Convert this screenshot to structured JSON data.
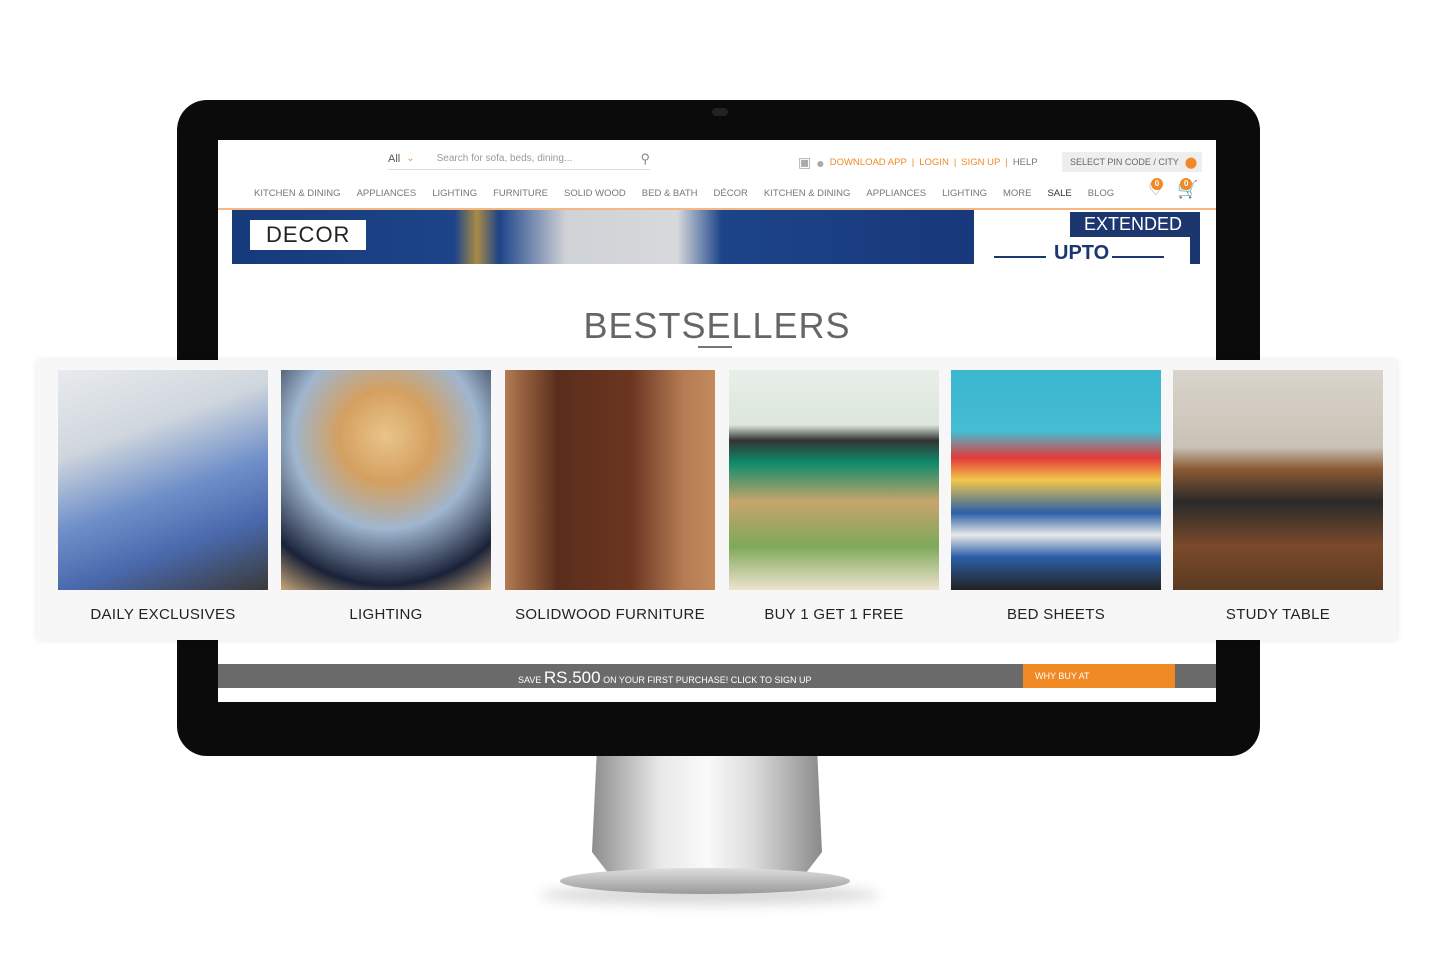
{
  "search": {
    "category": "All",
    "placeholder": "Search for sofa, beds, dining..."
  },
  "top_links": {
    "download": "DOWNLOAD APP",
    "login": "LOGIN",
    "signup": "SIGN UP",
    "help": "HELP",
    "sep": "|",
    "pin": "SELECT PIN CODE / CITY"
  },
  "nav": [
    "KITCHEN & DINING",
    "APPLIANCES",
    "LIGHTING",
    "FURNITURE",
    "SOLID WOOD",
    "BED & BATH",
    "DÉCOR",
    "KITCHEN & DINING",
    "APPLIANCES",
    "LIGHTING",
    "MORE",
    "SALE",
    "BLOG"
  ],
  "wishlist_count": "0",
  "cart_count": "0",
  "banner": {
    "decor": "DECOR",
    "extended": "EXTENDED",
    "partial": "UPTO"
  },
  "section_title": "BESTSELLERS",
  "bestsellers": [
    {
      "label": "DAILY EXCLUSIVES"
    },
    {
      "label": "LIGHTING"
    },
    {
      "label": "SOLIDWOOD FURNITURE"
    },
    {
      "label": "BUY 1 GET 1 FREE"
    },
    {
      "label": "BED SHEETS"
    },
    {
      "label": "STUDY TABLE"
    }
  ],
  "promo": {
    "save": "SAVE",
    "amount": "RS.500",
    "rest": "ON YOUR FIRST PURCHASE! CLICK TO SIGN UP",
    "why": "WHY BUY AT"
  },
  "colors": {
    "accent": "#f08a24",
    "navy": "#1c3670"
  }
}
